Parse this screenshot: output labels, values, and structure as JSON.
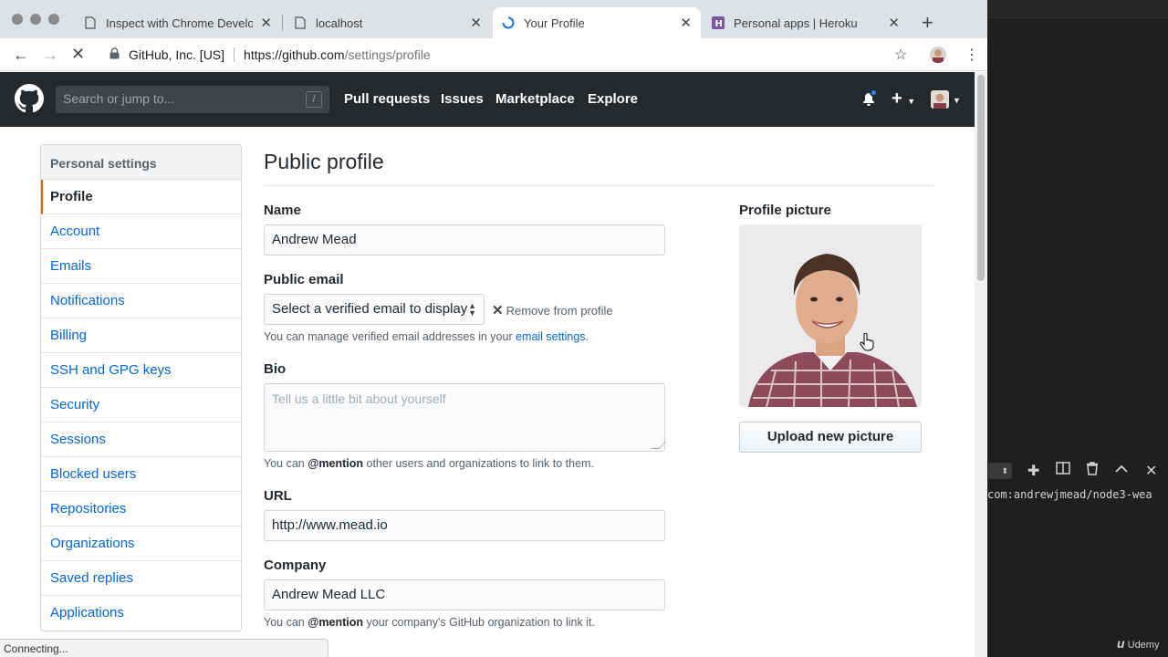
{
  "browser": {
    "tabs": [
      {
        "title": "Inspect with Chrome Develop",
        "icon": "page-icon"
      },
      {
        "title": "localhost",
        "icon": "page-icon"
      },
      {
        "title": "Your Profile",
        "icon": "loading-spinner-icon"
      },
      {
        "title": "Personal apps | Heroku",
        "icon": "heroku-icon"
      }
    ],
    "new_tab": "+",
    "omnibox": {
      "org": "GitHub, Inc. [US]",
      "host": "https://github.com",
      "path": "/settings/profile"
    },
    "status": "Connecting..."
  },
  "github": {
    "search_placeholder": "Search or jump to...",
    "search_key": "/",
    "nav": [
      "Pull requests",
      "Issues",
      "Marketplace",
      "Explore"
    ],
    "plus": "+"
  },
  "settings_menu": {
    "heading": "Personal settings",
    "items": [
      "Profile",
      "Account",
      "Emails",
      "Notifications",
      "Billing",
      "SSH and GPG keys",
      "Security",
      "Sessions",
      "Blocked users",
      "Repositories",
      "Organizations",
      "Saved replies",
      "Applications"
    ],
    "selected": "Profile"
  },
  "profile": {
    "title": "Public profile",
    "name_label": "Name",
    "name_value": "Andrew Mead",
    "email_label": "Public email",
    "email_select": "Select a verified email to display",
    "remove_label": "Remove from profile",
    "email_note_pre": "You can manage verified email addresses in your ",
    "email_note_link": "email settings",
    "email_note_post": ".",
    "bio_label": "Bio",
    "bio_placeholder": "Tell us a little bit about yourself",
    "bio_note_pre": "You can ",
    "bio_note_mention": "@mention",
    "bio_note_post": " other users and organizations to link to them.",
    "url_label": "URL",
    "url_value": "http://www.mead.io",
    "company_label": "Company",
    "company_value": "Andrew Mead LLC",
    "company_note_pre": "You can ",
    "company_note_mention": "@mention",
    "company_note_post": " your company's GitHub organization to link it.",
    "picture_label": "Profile picture",
    "upload_label": "Upload new picture"
  },
  "terminal": {
    "line": "com:andrewjmead/node3-wea"
  },
  "watermark": "Udemy",
  "colors": {
    "accent_link": "#0366d6",
    "header_bg": "#24292e",
    "selected_border": "#e36209"
  }
}
